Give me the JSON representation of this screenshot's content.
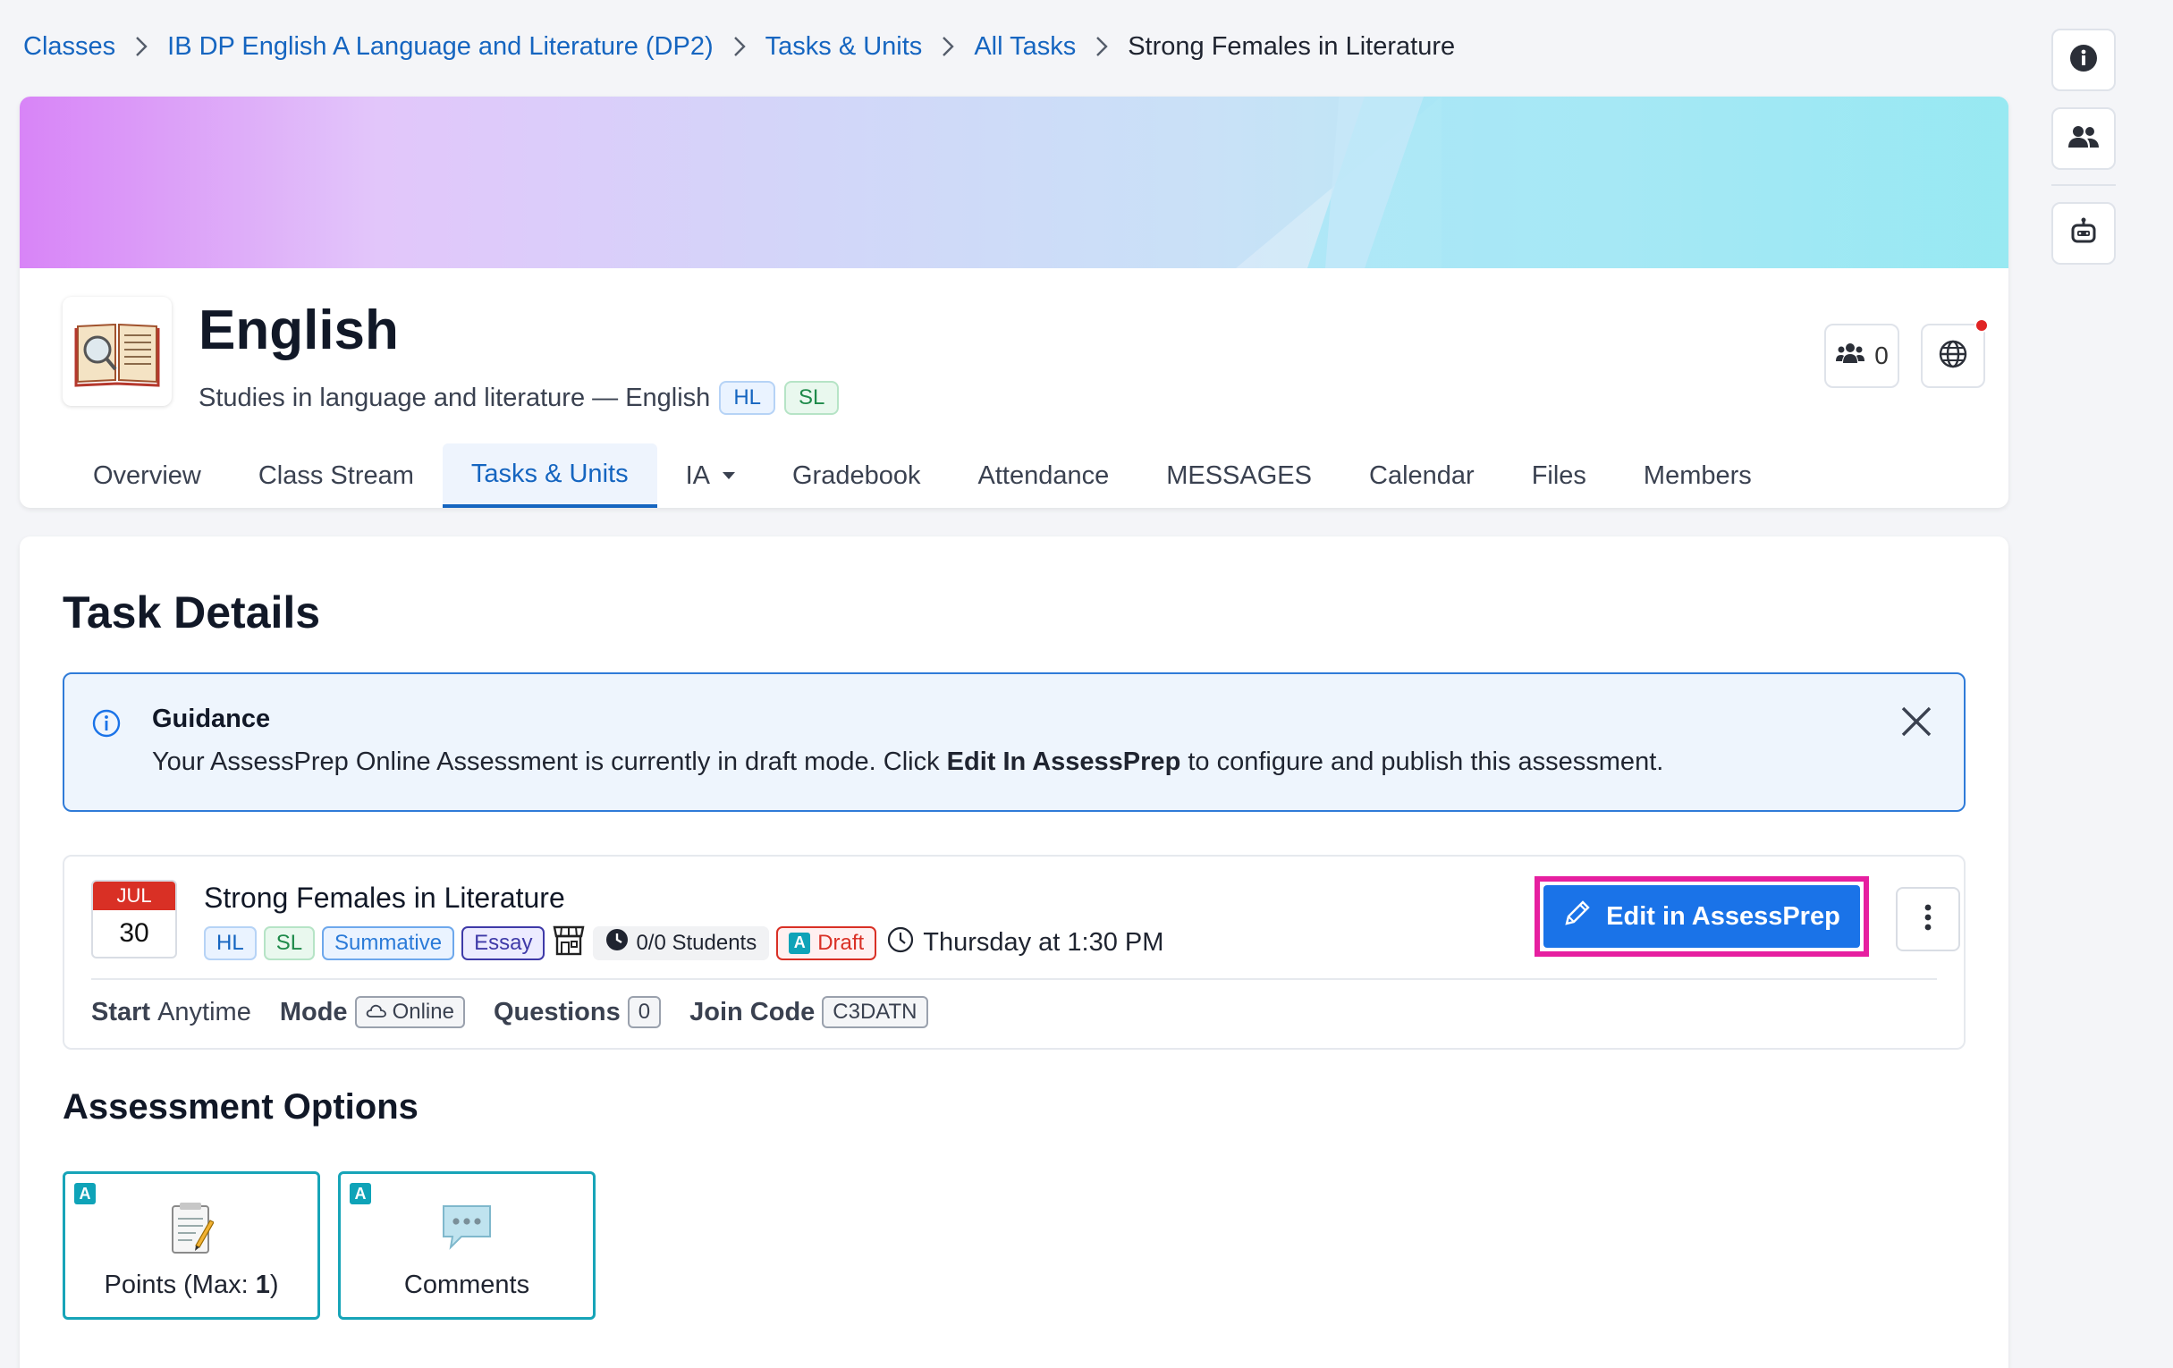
{
  "breadcrumb": {
    "items": [
      "Classes",
      "IB DP English A Language and Literature (DP2)",
      "Tasks & Units",
      "All Tasks"
    ],
    "current": "Strong Females in Literature"
  },
  "class": {
    "name": "English",
    "subtitle": "Studies in language and literature — English",
    "levels": [
      "HL",
      "SL"
    ],
    "member_count": "0"
  },
  "tabs": [
    {
      "label": "Overview"
    },
    {
      "label": "Class Stream"
    },
    {
      "label": "Tasks & Units",
      "active": true
    },
    {
      "label": "IA"
    },
    {
      "label": "Gradebook"
    },
    {
      "label": "Attendance"
    },
    {
      "label": "MESSAGES"
    },
    {
      "label": "Calendar"
    },
    {
      "label": "Files"
    },
    {
      "label": "Members"
    }
  ],
  "page_title": "Task Details",
  "guidance": {
    "title": "Guidance",
    "text_before": "Your AssessPrep Online Assessment is currently in draft mode. Click ",
    "text_bold": "Edit In AssessPrep",
    "text_after": " to configure and publish this assessment."
  },
  "task": {
    "month": "JUL",
    "day": "30",
    "name": "Strong Females in Literature",
    "tags": {
      "hl": "HL",
      "sl": "SL",
      "type": "Summative",
      "format": "Essay",
      "students": "0/0 Students",
      "draft_badge": "A",
      "status": "Draft"
    },
    "due": "Thursday at 1:30 PM",
    "edit_button": "Edit in AssessPrep",
    "meta": {
      "start_label": "Start",
      "start_value": "Anytime",
      "mode_label": "Mode",
      "mode_value": "Online",
      "questions_label": "Questions",
      "questions_value": "0",
      "join_label": "Join Code",
      "join_value": "C3DATN"
    }
  },
  "assessment_options": {
    "title": "Assessment Options",
    "badge": "A",
    "points_prefix": "Points (Max: ",
    "points_max": "1",
    "points_suffix": ")",
    "comments": "Comments"
  },
  "colors": {
    "primary": "#1a73e8",
    "link": "#1565c0",
    "highlight": "#e61fa0",
    "draft": "#d93025",
    "teal": "#17a4b8"
  },
  "icons": {
    "rail": [
      "info-icon",
      "people-icon",
      "robot-icon"
    ],
    "header": [
      "members-icon",
      "globe-icon"
    ],
    "task": [
      "store-icon",
      "clock-filled-icon",
      "clock-icon",
      "pencil-icon",
      "kebab-icon",
      "cloud-icon"
    ],
    "options": [
      "notepad-icon",
      "speech-bubble-icon"
    ]
  }
}
